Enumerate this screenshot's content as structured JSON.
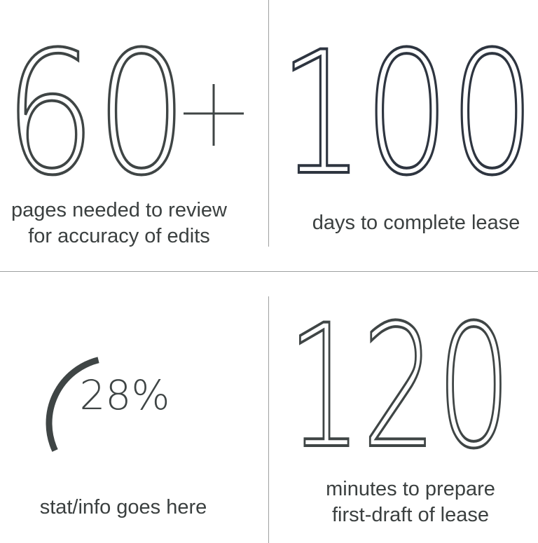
{
  "stats": [
    {
      "value": "60",
      "suffix": "+",
      "caption_line1": "pages needed to review",
      "caption_line2": "for accuracy of edits",
      "color": "#3f4545"
    },
    {
      "value": "100",
      "caption_line1": "days to complete lease",
      "color": "#2e3540"
    },
    {
      "value": "28%",
      "progress_fraction": 0.28,
      "caption_line1": "stat/info goes here",
      "color": "#3f4545"
    },
    {
      "value": "120",
      "caption_line1": "minutes to prepare",
      "caption_line2": "first-draft of lease",
      "color": "#3f4545"
    }
  ]
}
